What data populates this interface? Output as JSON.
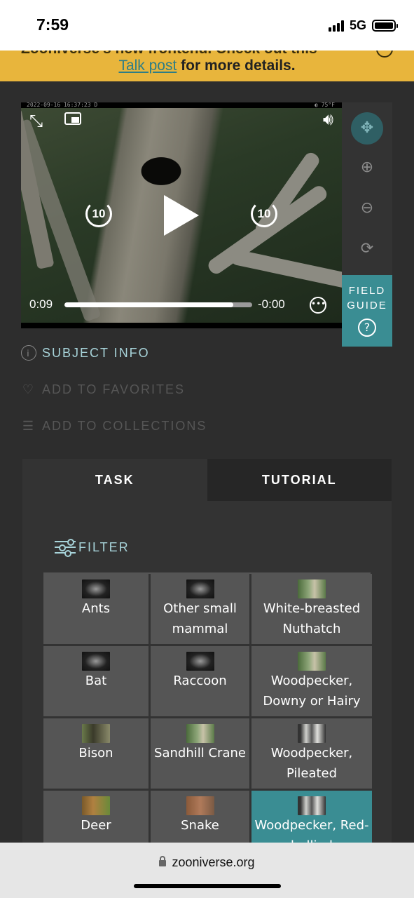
{
  "status_bar": {
    "time": "7:59",
    "network": "5G",
    "signal_bars": 4,
    "battery_level": 1.0
  },
  "banner": {
    "top_partial_text": "Zooniverse's new frontend. Check out this",
    "link_text": "Talk post",
    "rest_text": " for more details."
  },
  "video": {
    "timestamp_overlay": "2022-09-16 16:37:23      D",
    "temperature_overlay": "◐  75°F",
    "skip_back_label": "10",
    "skip_forward_label": "10",
    "current_time": "0:09",
    "remaining_time": "-0:00",
    "progress": 0.9
  },
  "toolbar": {
    "tools": [
      "move-icon",
      "zoom-in-icon",
      "zoom-out-icon",
      "rotate-icon"
    ]
  },
  "field_guide": {
    "label_line1": "FIELD",
    "label_line2": "GUIDE",
    "help": "?"
  },
  "subject_links": {
    "info": "SUBJECT INFO",
    "favorites": "ADD TO FAVORITES",
    "collections": "ADD TO COLLECTIONS"
  },
  "tabs": {
    "task": "TASK",
    "tutorial": "TUTORIAL"
  },
  "task": {
    "filter_label": "FILTER",
    "choices": [
      {
        "label": "Ants",
        "thumb": "dark"
      },
      {
        "label": "Other small mammal",
        "thumb": "dark"
      },
      {
        "label": "White-breasted Nuthatch",
        "thumb": "green"
      },
      {
        "label": "Bat",
        "thumb": "dark"
      },
      {
        "label": "Raccoon",
        "thumb": "dark"
      },
      {
        "label": "Woodpecker, Downy or Hairy",
        "thumb": "green"
      },
      {
        "label": "Bison",
        "thumb": "bison"
      },
      {
        "label": "Sandhill Crane",
        "thumb": "green"
      },
      {
        "label": "Woodpecker, Pileated",
        "thumb": "bark"
      },
      {
        "label": "Deer",
        "thumb": "deer"
      },
      {
        "label": "Snake",
        "thumb": "snake"
      },
      {
        "label": "Woodpecker, Red-bellied",
        "thumb": "bark",
        "selected": true
      }
    ]
  },
  "browser": {
    "url": "zooniverse.org"
  },
  "colors": {
    "accent": "#3a8d93",
    "banner": "#e8b53c",
    "link": "#a7d3d9",
    "background": "#2d2d2d"
  }
}
